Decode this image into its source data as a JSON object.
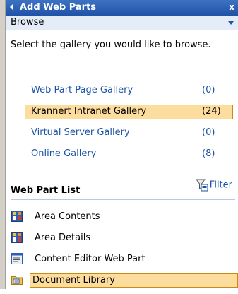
{
  "panel": {
    "title": "Add Web Parts",
    "close_label": "x"
  },
  "browse": {
    "label": "Browse"
  },
  "instructions": "Select the gallery you would like to browse.",
  "galleries": [
    {
      "name": "Web Part Page Gallery",
      "count": "(0)"
    },
    {
      "name": "Krannert Intranet Gallery",
      "count": "(24)",
      "selected": true
    },
    {
      "name": "Virtual Server Gallery",
      "count": "(0)"
    },
    {
      "name": "Online Gallery",
      "count": "(8)"
    }
  ],
  "web_part_list": {
    "heading": "Web Part List",
    "filter_label": "Filter",
    "items": [
      {
        "label": "Area Contents",
        "icon": "web-part-icon"
      },
      {
        "label": "Area Details",
        "icon": "web-part-icon"
      },
      {
        "label": "Content Editor Web Part",
        "icon": "content-editor-icon"
      },
      {
        "label": "Document Library",
        "icon": "folder-icon",
        "selected": true
      }
    ]
  },
  "colors": {
    "title_bar": "#2053a8",
    "link": "#1a52a6",
    "selection_fill": "#fcdd9e",
    "selection_border": "#c88a12"
  }
}
